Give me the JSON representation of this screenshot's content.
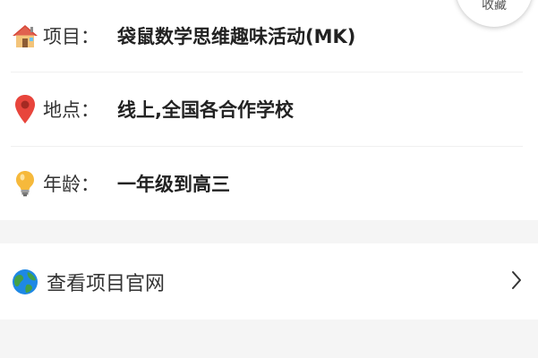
{
  "info": {
    "project": {
      "icon": "house-icon",
      "label": "项目：",
      "value": "袋鼠数学思维趣味活动(MK)"
    },
    "location": {
      "icon": "map-pin-icon",
      "label": "地点：",
      "value": "线上,全国各合作学校"
    },
    "age": {
      "icon": "lightbulb-icon",
      "label": "年龄：",
      "value": "一年级到高三"
    }
  },
  "website_link": {
    "icon": "globe-icon",
    "label": "查看项目官网"
  },
  "favorite": {
    "label": "收藏"
  },
  "colors": {
    "background": "#f5f5f5",
    "card": "#ffffff",
    "pin_red": "#e8453c",
    "bulb_yellow": "#f6b93b",
    "globe_blue": "#1e88e5",
    "globe_green": "#43a047"
  }
}
